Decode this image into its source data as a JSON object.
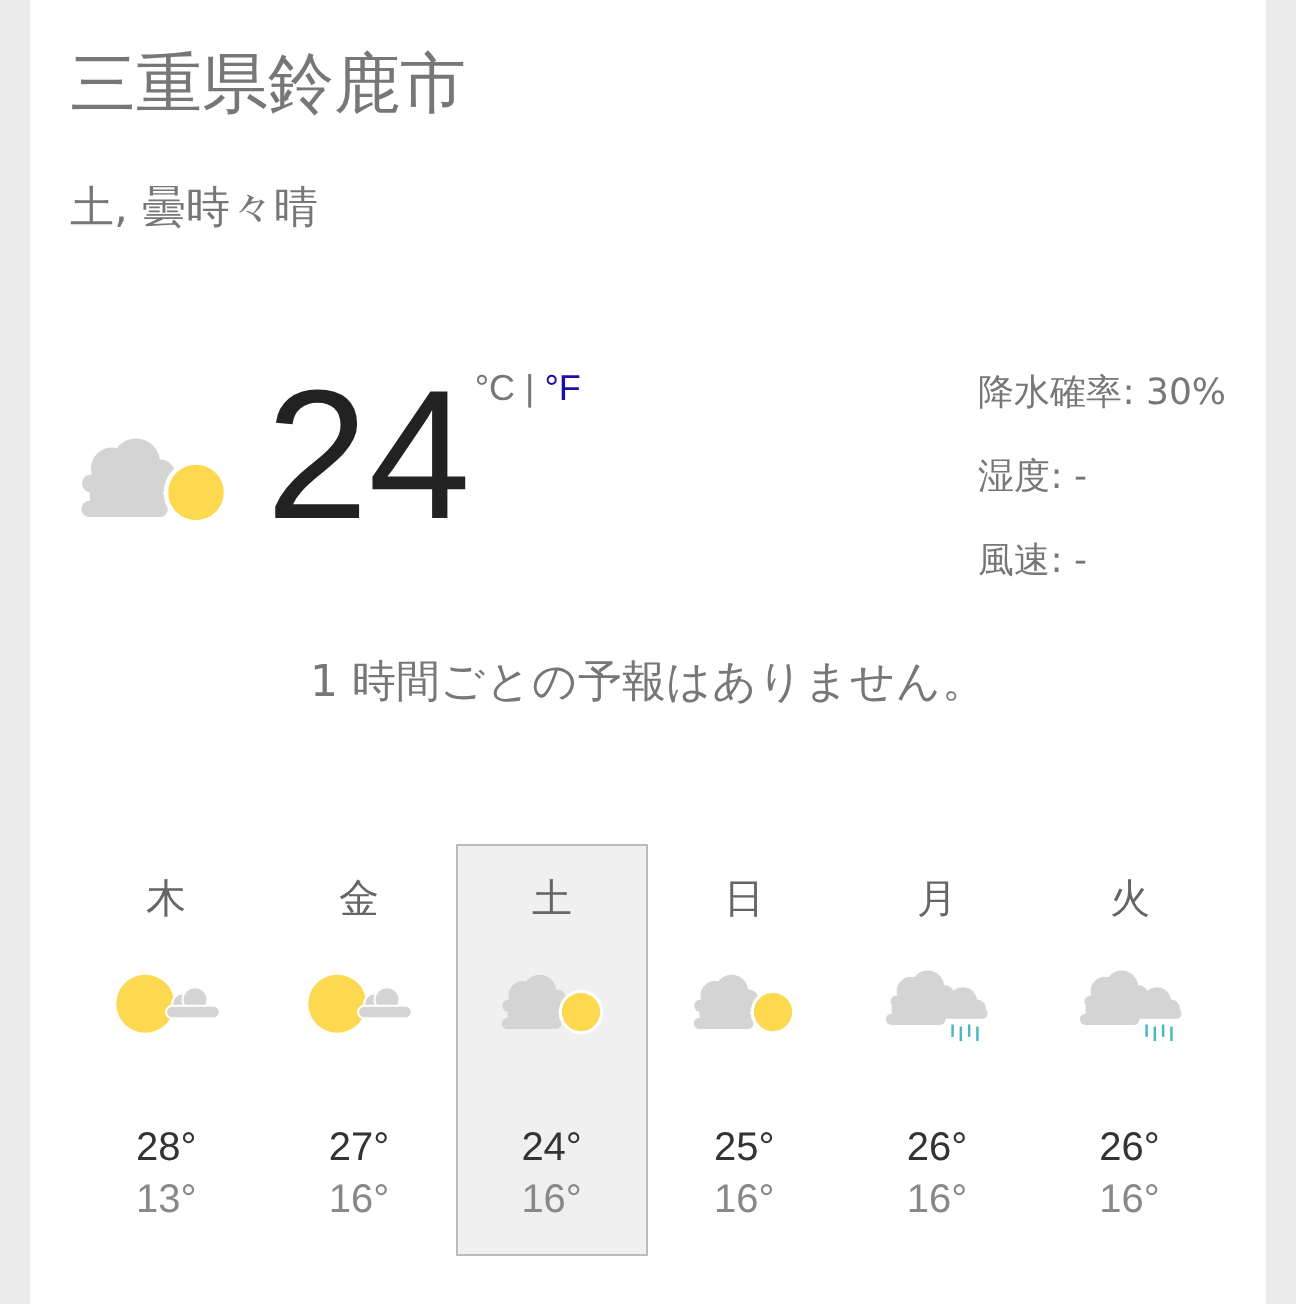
{
  "location": "三重県鈴鹿市",
  "summary": "土, 曇時々晴",
  "current": {
    "kind": "cloudy-sunny",
    "temperature": "24",
    "units": [
      {
        "label": "°C",
        "selected": true
      },
      {
        "label": "°F",
        "selected": false
      }
    ],
    "separator": "|"
  },
  "details": [
    "降水確率: 30%",
    "湿度: -",
    "風速: -"
  ],
  "hourly_message": "1 時間ごとの予報はありません。",
  "days": [
    {
      "day": "木",
      "kind": "sunny-cloudy",
      "high": "28°",
      "low": "13°",
      "selected": false
    },
    {
      "day": "金",
      "kind": "sunny-cloudy",
      "high": "27°",
      "low": "16°",
      "selected": false
    },
    {
      "day": "土",
      "kind": "cloudy-sunny",
      "high": "24°",
      "low": "16°",
      "selected": true
    },
    {
      "day": "日",
      "kind": "cloudy-sunny",
      "high": "25°",
      "low": "16°",
      "selected": false
    },
    {
      "day": "月",
      "kind": "rain",
      "high": "26°",
      "low": "16°",
      "selected": false
    },
    {
      "day": "火",
      "kind": "rain",
      "high": "26°",
      "low": "16°",
      "selected": false
    }
  ]
}
